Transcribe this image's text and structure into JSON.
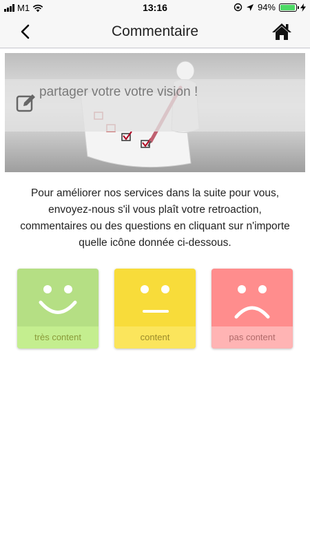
{
  "status_bar": {
    "carrier": "M1",
    "time": "13:16",
    "battery_percent": "94%",
    "battery_level": 0.94
  },
  "nav": {
    "title": "Commentaire",
    "back_icon": "chevron-left-icon",
    "home_icon": "home-icon"
  },
  "hero": {
    "text": "partager votre votre vision !",
    "icon": "edit-icon"
  },
  "intro": {
    "text": "Pour améliorer nos services dans la suite pour vous, envoyez-nous s'il vous plaît votre retroaction, commentaires ou des questions en cliquant sur n'importe quelle icône donnée ci-dessous."
  },
  "moods": [
    {
      "label": "très content",
      "icon": "happy-face-icon",
      "color": "#b5df84"
    },
    {
      "label": "content",
      "icon": "neutral-face-icon",
      "color": "#f8dc3a"
    },
    {
      "label": "pas content",
      "icon": "sad-face-icon",
      "color": "#ff8d8d"
    }
  ]
}
